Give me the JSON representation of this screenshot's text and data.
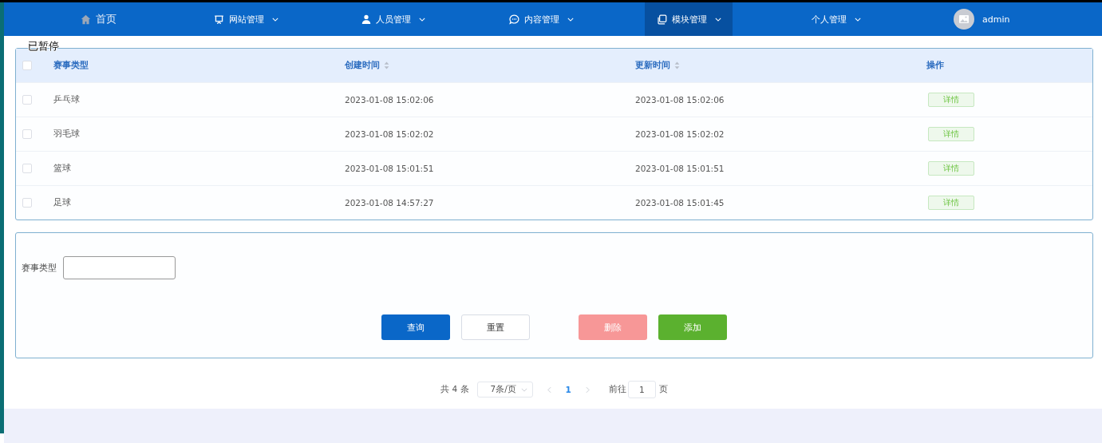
{
  "overlay_status": "已暂停",
  "nav": {
    "items": [
      {
        "label": "首页",
        "kind": "home",
        "dropdown": false,
        "selected": false
      },
      {
        "label": "网站管理",
        "kind": "screen",
        "dropdown": true,
        "selected": false
      },
      {
        "label": "人员管理",
        "kind": "user",
        "dropdown": true,
        "selected": false
      },
      {
        "label": "内容管理",
        "kind": "chat",
        "dropdown": true,
        "selected": false
      },
      {
        "label": "模块管理",
        "kind": "copy",
        "dropdown": true,
        "selected": true
      },
      {
        "label": "个人管理",
        "kind": "plain",
        "dropdown": true,
        "selected": false
      }
    ],
    "user": {
      "name": "admin"
    }
  },
  "table": {
    "select_all_checked": false,
    "columns": [
      {
        "label": "赛事类型",
        "sortable": false
      },
      {
        "label": "创建时间",
        "sortable": true
      },
      {
        "label": "更新时间",
        "sortable": true
      },
      {
        "label": "操作",
        "sortable": false
      }
    ],
    "rows": [
      {
        "checked": false,
        "cells": [
          "乒乓球",
          "2023-01-08 15:02:06",
          "2023-01-08 15:02:06"
        ],
        "action": "详情"
      },
      {
        "checked": false,
        "cells": [
          "羽毛球",
          "2023-01-08 15:02:02",
          "2023-01-08 15:02:02"
        ],
        "action": "详情"
      },
      {
        "checked": false,
        "cells": [
          "篮球",
          "2023-01-08 15:01:51",
          "2023-01-08 15:01:51"
        ],
        "action": "详情"
      },
      {
        "checked": false,
        "cells": [
          "足球",
          "2023-01-08 14:57:27",
          "2023-01-08 15:01:45"
        ],
        "action": "详情"
      }
    ]
  },
  "search": {
    "label": "赛事类型",
    "buttons": [
      {
        "label": "查询",
        "kind": "primary",
        "disabled": false
      },
      {
        "label": "重置",
        "kind": "default",
        "disabled": false
      },
      {
        "label": "删除",
        "kind": "danger",
        "disabled": true
      },
      {
        "label": "添加",
        "kind": "success",
        "disabled": false
      }
    ]
  },
  "pagination": {
    "total": "共 4 条",
    "page_size": "7条/页",
    "pages": [
      {
        "label": "1",
        "selected": true
      }
    ],
    "goto_label": "前往",
    "goto_value": "1",
    "goto_suffix": "页"
  }
}
